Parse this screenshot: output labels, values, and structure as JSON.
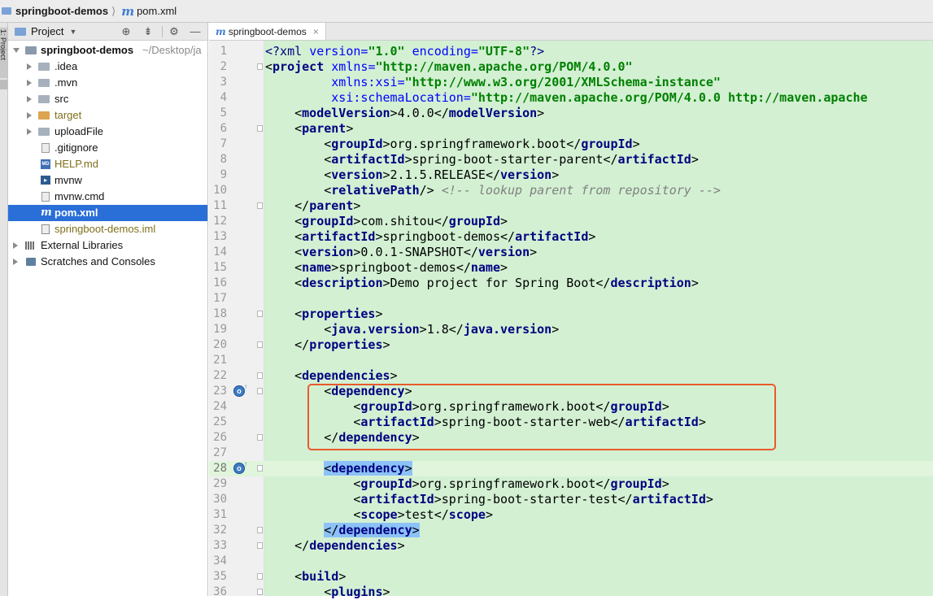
{
  "navbar": {
    "project_name": "springboot-demos",
    "file_name": "pom.xml"
  },
  "toolstrip": {
    "project_tab": "1: Project"
  },
  "project_panel": {
    "title": "Project",
    "tree": [
      {
        "id": "root",
        "name": "springboot-demos",
        "path": "~/Desktop/ja",
        "type": "root",
        "expanded": true
      },
      {
        "id": "idea",
        "name": ".idea",
        "type": "folder"
      },
      {
        "id": "mvn",
        "name": ".mvn",
        "type": "folder"
      },
      {
        "id": "src",
        "name": "src",
        "type": "folder"
      },
      {
        "id": "target",
        "name": "target",
        "type": "folder-excluded"
      },
      {
        "id": "uploadFile",
        "name": "uploadFile",
        "type": "folder"
      },
      {
        "id": "gitignore",
        "name": ".gitignore",
        "type": "file"
      },
      {
        "id": "help",
        "name": "HELP.md",
        "type": "md",
        "icon_text": "MD"
      },
      {
        "id": "mvnw",
        "name": "mvnw",
        "type": "terminal",
        "icon_text": "▸"
      },
      {
        "id": "mvnwcmd",
        "name": "mvnw.cmd",
        "type": "file"
      },
      {
        "id": "pom",
        "name": "pom.xml",
        "type": "maven",
        "selected": true
      },
      {
        "id": "iml",
        "name": "springboot-demos.iml",
        "type": "iml"
      },
      {
        "id": "libs",
        "name": "External Libraries",
        "type": "libraries"
      },
      {
        "id": "scratches",
        "name": "Scratches and Consoles",
        "type": "scratches"
      }
    ]
  },
  "editor": {
    "tab_label": "springboot-demos",
    "tab_close": "×",
    "lines": [
      "1",
      "2",
      "3",
      "4",
      "5",
      "6",
      "7",
      "8",
      "9",
      "10",
      "11",
      "12",
      "13",
      "14",
      "15",
      "16",
      "17",
      "18",
      "19",
      "20",
      "21",
      "22",
      "23",
      "24",
      "25",
      "26",
      "27",
      "28",
      "29",
      "30",
      "31",
      "32",
      "33",
      "34",
      "35",
      "36"
    ],
    "code": {
      "l1_pi": "<?xml",
      "l1_a1": "version",
      "l1_v1": "\"1.0\"",
      "l1_a2": "encoding",
      "l1_v2": "\"UTF-8\"",
      "l1_end": "?>",
      "l2_tag": "project",
      "l2_a": "xmlns",
      "l2_v": "\"http://maven.apache.org/POM/4.0.0\"",
      "l3_a": "xmlns:xsi",
      "l3_v": "\"http://www.w3.org/2001/XMLSchema-instance\"",
      "l4_a": "xsi:schemaLocation",
      "l4_v": "\"http://maven.apache.org/POM/4.0.0 http://maven.apache",
      "modelVersion": "modelVersion",
      "modelVersion_val": "4.0.0",
      "parent": "parent",
      "groupId": "groupId",
      "artifactId": "artifactId",
      "version": "version",
      "relativePath": "relativePath",
      "parent_groupId": "org.springframework.boot",
      "parent_artifactId": "spring-boot-starter-parent",
      "parent_version": "2.1.5.RELEASE",
      "relativePath_comment": "<!-- lookup parent from repository -->",
      "proj_groupId": "com.shitou",
      "proj_artifactId": "springboot-demos",
      "proj_version": "0.0.1-SNAPSHOT",
      "name": "name",
      "name_val": "springboot-demos",
      "description": "description",
      "description_val": "Demo project for Spring Boot",
      "properties": "properties",
      "java_version": "java.version",
      "java_version_val": "1.8",
      "dependencies": "dependencies",
      "dependency": "dependency",
      "dep1_groupId": "org.springframework.boot",
      "dep1_artifactId": "spring-boot-starter-web",
      "dep2_groupId": "org.springframework.boot",
      "dep2_artifactId": "spring-boot-starter-test",
      "scope": "scope",
      "scope_val": "test",
      "build": "build",
      "plugins": "plugins"
    }
  },
  "colors": {
    "selection": "#2a6ed8",
    "code_bg": "#d3f0d3",
    "tag": "#000080",
    "attr_value": "#008000",
    "annotation_box": "#e85a2b",
    "match_highlight": "#8cc2f7"
  }
}
